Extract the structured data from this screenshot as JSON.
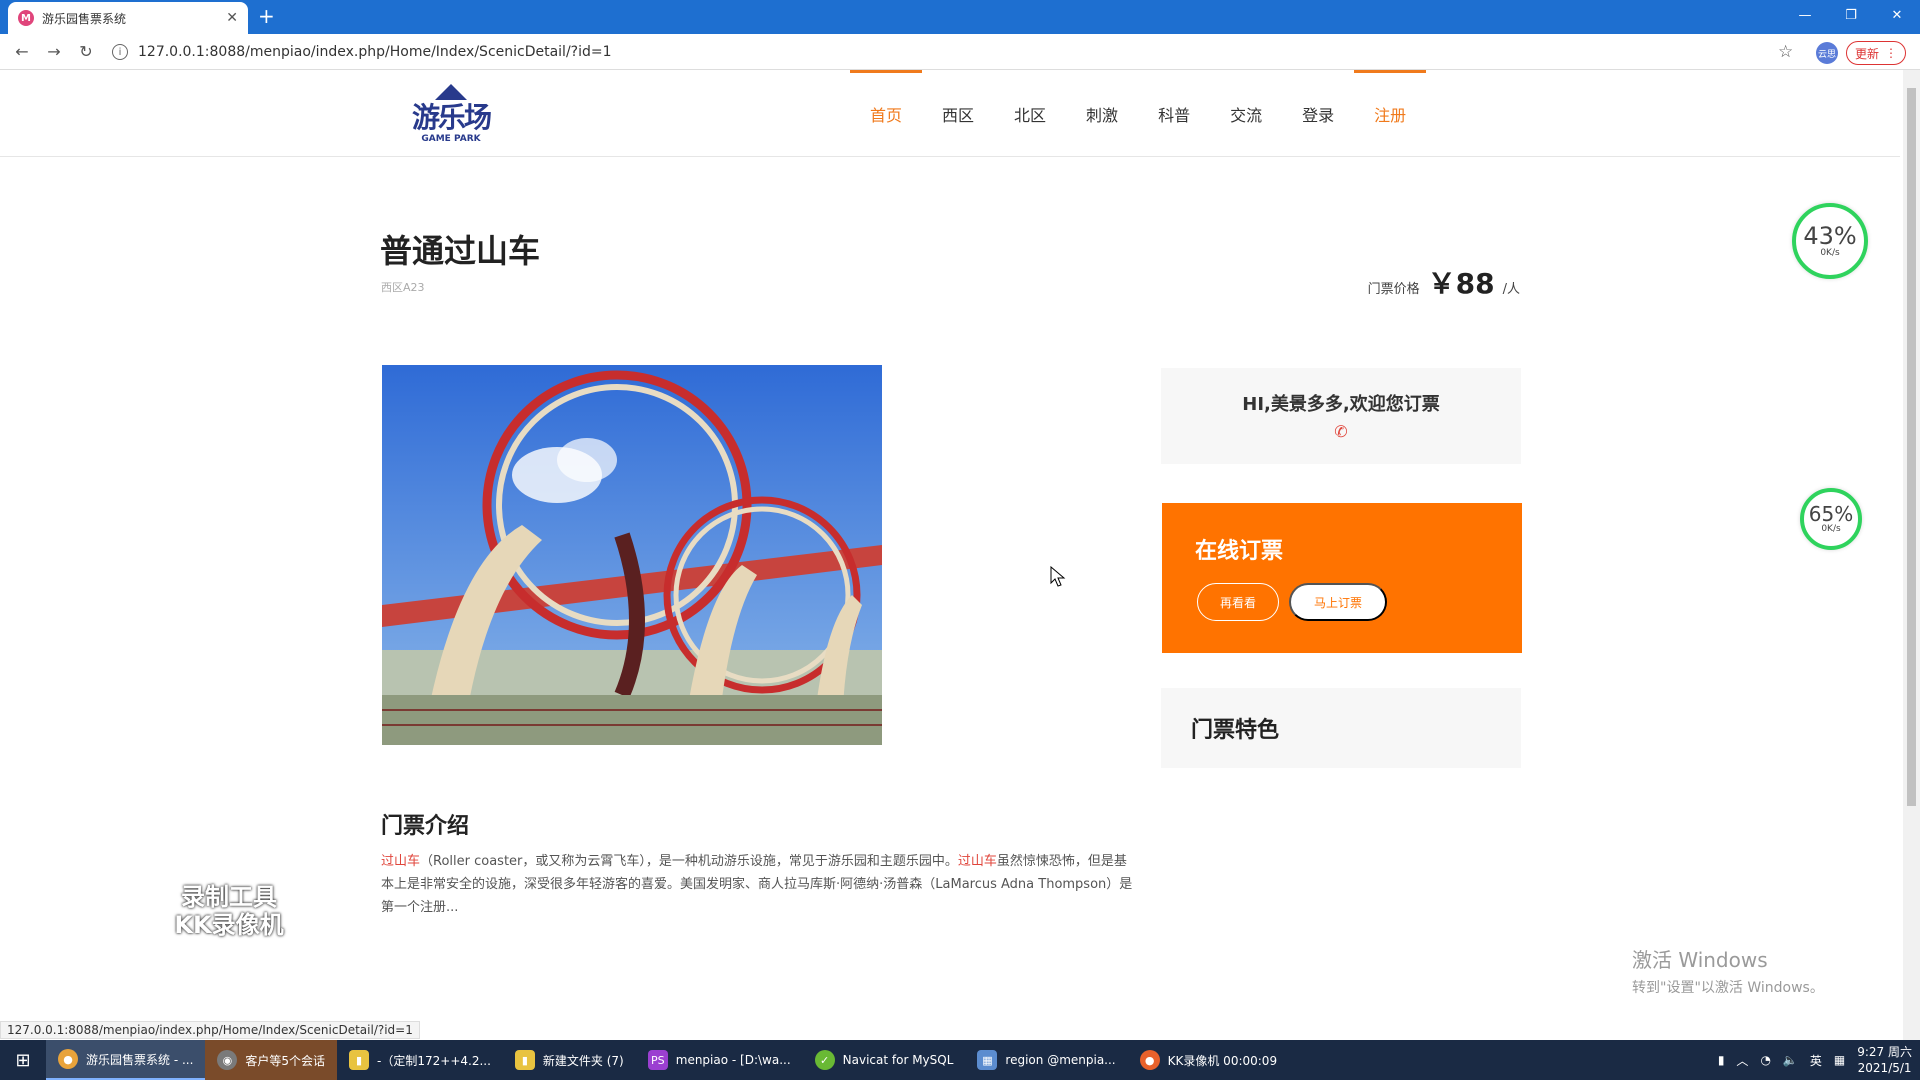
{
  "browser": {
    "tab_title": "游乐园售票系统",
    "tab_favicon": "M",
    "url": "127.0.0.1:8088/menpiao/index.php/Home/Index/ScenicDetail/?id=1",
    "update_label": "更新",
    "profile_label": "云思"
  },
  "site": {
    "logo_text": "游乐场",
    "logo_sub": "GAME PARK",
    "nav": [
      "首页",
      "西区",
      "北区",
      "刺激",
      "科普",
      "交流",
      "登录",
      "注册"
    ]
  },
  "detail": {
    "title": "普通过山车",
    "location": "西区A23",
    "price_label": "门票价格",
    "price_value": "￥88",
    "price_unit": "/人",
    "intro_title": "门票介绍",
    "intro_hl1": "过山车",
    "intro_part1": "（Roller coaster，或又称为云霄飞车），是一种机动游乐设施，常见于游乐园和主题乐园中。",
    "intro_hl2": "过山车",
    "intro_part2": "虽然惊悚恐怖，但是基本上是非常安全的设施，深受很多年轻游客的喜爱。美国发明家、商人拉马库斯·阿德纳·汤普森（LaMarcus Adna Thompson）是第一个注册...",
    "welcome_text": "HI,美景多多,欢迎您订票",
    "order_title": "在线订票",
    "btn_more": "再看看",
    "btn_buy": "马上订票",
    "feature_title": "门票特色"
  },
  "gauges": [
    {
      "pct": "43%",
      "speed": "0K/s"
    },
    {
      "pct": "65%",
      "speed": "0K/s"
    }
  ],
  "watermark": {
    "kk_line1": "录制工具",
    "kk_line2": "KK录像机",
    "activate_line1": "激活 Windows",
    "activate_line2": "转到\"设置\"以激活 Windows。"
  },
  "status_url": "127.0.0.1:8088/menpiao/index.php/Home/Index/ScenicDetail/?id=1",
  "taskbar": {
    "items": [
      {
        "label": "游乐园售票系统 - ...",
        "icon_color": "#e8a33b"
      },
      {
        "label": "客户等5个会话",
        "icon_color": "#7a7a7a"
      },
      {
        "label": "-（定制172++4.2...",
        "icon_color": "#e8c340"
      },
      {
        "label": "新建文件夹 (7)",
        "icon_color": "#e8c340"
      },
      {
        "label": "menpiao - [D:\\wa...",
        "icon_color": "#9b3fd1"
      },
      {
        "label": "Navicat for MySQL",
        "icon_color": "#69b934"
      },
      {
        "label": "region @menpia...",
        "icon_color": "#5b8ccf"
      },
      {
        "label": "KK录像机 00:00:09",
        "icon_color": "#e8612b"
      }
    ],
    "ime": "英",
    "time": "9:27 周六",
    "date": "2021/5/1"
  }
}
